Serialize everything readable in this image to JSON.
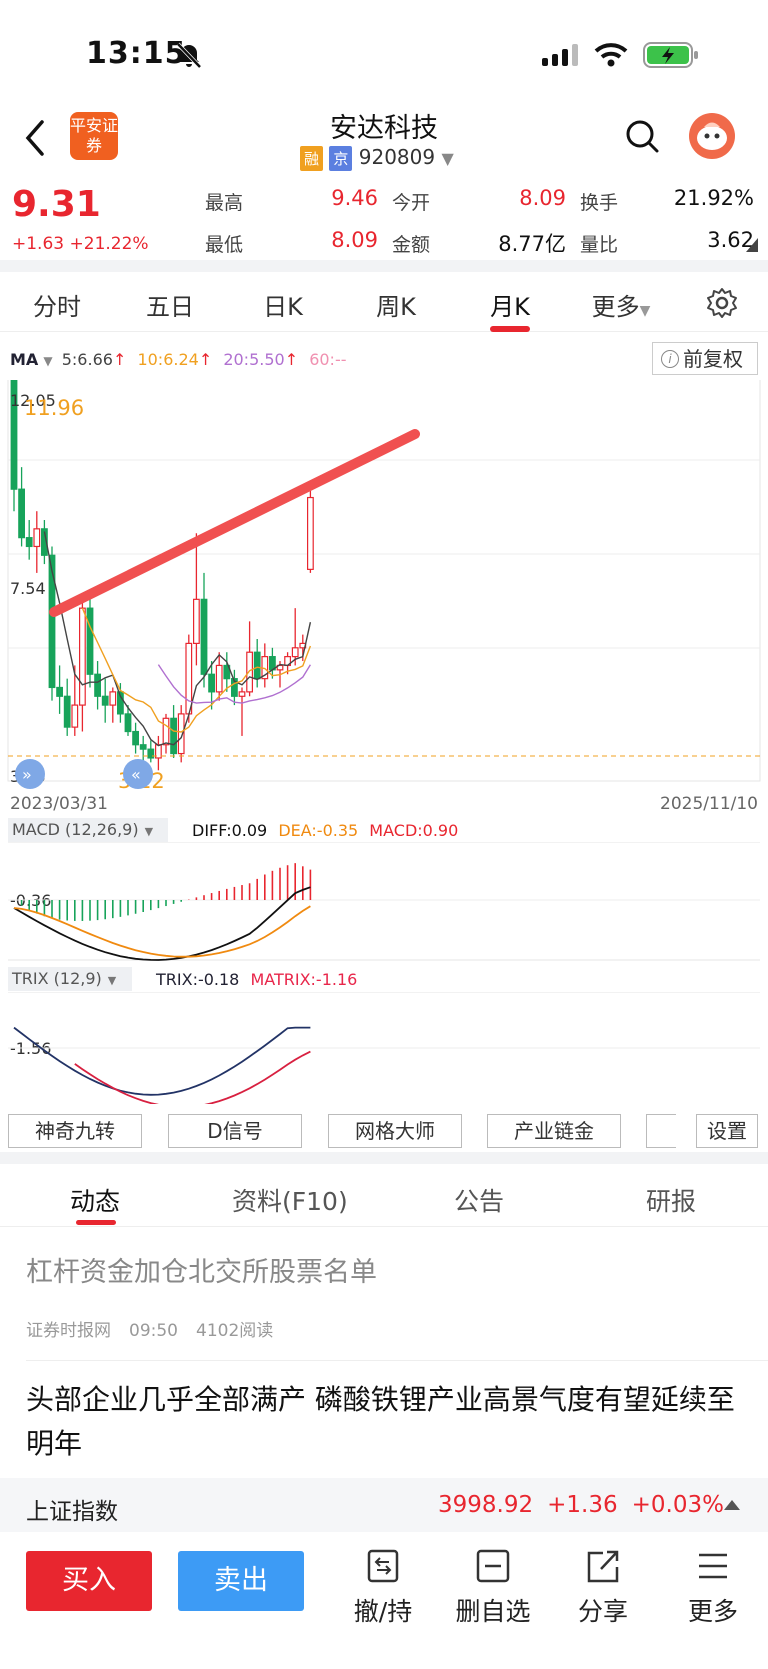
{
  "status": {
    "time": "13:15"
  },
  "header": {
    "broker_logo": "平安证券",
    "name": "安达科技",
    "tag1": "融",
    "tag2": "京",
    "code": "920809"
  },
  "quote": {
    "price": "9.31",
    "change": "+1.63",
    "change_pct": "+21.22%",
    "high_label": "最高",
    "high": "9.46",
    "open_label": "今开",
    "open": "8.09",
    "turnover_label": "换手",
    "turnover": "21.92%",
    "low_label": "最低",
    "low": "8.09",
    "amount_label": "金额",
    "amount": "8.77亿",
    "vol_ratio_label": "量比",
    "vol_ratio": "3.62"
  },
  "tabs": [
    "分时",
    "五日",
    "日K",
    "周K",
    "月K",
    "更多"
  ],
  "active_tab": "月K",
  "ma": {
    "label": "MA",
    "ma5": "5:6.66",
    "ma10": "10:6.24",
    "ma20": "20:5.50",
    "ma60": "60:--"
  },
  "fuquan_label": "前复权",
  "colors": {
    "up": "#e8262f",
    "down": "#17a35a",
    "ma5": "#444444",
    "ma10": "#f0a020",
    "ma20": "#b070d0",
    "ma60": "#f090b0",
    "trend": "#f05050"
  },
  "chart_data": {
    "type": "candlestick",
    "y_labels": [
      "12.05",
      "7.54",
      "3.23"
    ],
    "annot_high": "11.96",
    "annot_low": "3.12",
    "start_date": "2023/03/31",
    "end_date": "2025/11/10",
    "candles": [
      [
        12.05,
        12.05,
        9.0,
        9.5
      ],
      [
        9.5,
        10.0,
        8.2,
        8.4
      ],
      [
        8.4,
        8.8,
        7.9,
        8.2
      ],
      [
        8.2,
        9.0,
        7.6,
        8.6
      ],
      [
        8.6,
        8.8,
        7.8,
        8.0
      ],
      [
        8.0,
        8.2,
        4.7,
        5.0
      ],
      [
        5.0,
        5.5,
        4.4,
        4.8
      ],
      [
        4.8,
        5.2,
        3.9,
        4.1
      ],
      [
        4.1,
        5.5,
        3.9,
        4.6
      ],
      [
        4.6,
        7.0,
        4.0,
        6.8
      ],
      [
        6.8,
        7.2,
        5.0,
        5.3
      ],
      [
        5.3,
        5.6,
        4.5,
        4.8
      ],
      [
        4.8,
        5.2,
        4.2,
        4.6
      ],
      [
        4.6,
        5.0,
        4.2,
        4.9
      ],
      [
        4.9,
        5.1,
        4.2,
        4.4
      ],
      [
        4.4,
        4.6,
        3.9,
        4.0
      ],
      [
        4.0,
        4.2,
        3.5,
        3.7
      ],
      [
        3.7,
        3.9,
        3.3,
        3.6
      ],
      [
        3.6,
        3.8,
        3.3,
        3.4
      ],
      [
        3.4,
        3.9,
        3.12,
        3.7
      ],
      [
        3.7,
        4.4,
        3.5,
        4.3
      ],
      [
        4.3,
        4.6,
        3.4,
        3.5
      ],
      [
        3.5,
        4.6,
        3.3,
        4.4
      ],
      [
        4.4,
        6.2,
        4.2,
        6.0
      ],
      [
        6.0,
        8.5,
        5.5,
        7.0
      ],
      [
        7.0,
        7.6,
        5.0,
        5.3
      ],
      [
        5.3,
        5.6,
        4.5,
        4.9
      ],
      [
        4.9,
        5.8,
        4.7,
        5.5
      ],
      [
        5.5,
        5.8,
        4.9,
        5.2
      ],
      [
        5.2,
        5.4,
        4.6,
        4.8
      ],
      [
        4.8,
        5.0,
        3.9,
        4.9
      ],
      [
        4.9,
        6.5,
        4.8,
        5.8
      ],
      [
        5.8,
        6.1,
        5.0,
        5.2
      ],
      [
        5.2,
        6.0,
        5.0,
        5.7
      ],
      [
        5.7,
        5.9,
        5.2,
        5.4
      ],
      [
        5.4,
        5.6,
        5.0,
        5.5
      ],
      [
        5.5,
        5.8,
        5.3,
        5.7
      ],
      [
        5.7,
        6.8,
        5.5,
        5.9
      ],
      [
        5.9,
        6.2,
        5.6,
        6.0
      ],
      [
        7.68,
        9.46,
        7.6,
        9.31
      ]
    ],
    "macd": {
      "label": "MACD (12,26,9)",
      "diff": "DIFF:0.09",
      "dea": "DEA:-0.35",
      "macd": "MACD:0.90",
      "ylabel": "-0.36"
    },
    "trix": {
      "label": "TRIX (12,9)",
      "trix": "TRIX:-0.18",
      "matrix": "MATRIX:-1.16",
      "ylabel": "-1.56"
    }
  },
  "tools": [
    "神奇九转",
    "D信号",
    "网格大师",
    "产业链金",
    "设置"
  ],
  "news_tabs": [
    "动态",
    "资料(F10)",
    "公告",
    "研报"
  ],
  "news": [
    {
      "title": "杠杆资金加仓北交所股票名单",
      "source": "证券时报网",
      "time": "09:50",
      "reads": "4102阅读"
    },
    {
      "title": "头部企业几乎全部满产 磷酸铁锂产业高景气度有望延续至明年"
    }
  ],
  "index_bar": {
    "name": "上证指数",
    "value": "3998.92",
    "change": "+1.36",
    "pct": "+0.03%"
  },
  "bottom": {
    "buy": "买入",
    "sell": "卖出",
    "b1": "撤/持",
    "b2": "删自选",
    "b3": "分享",
    "b4": "更多"
  }
}
